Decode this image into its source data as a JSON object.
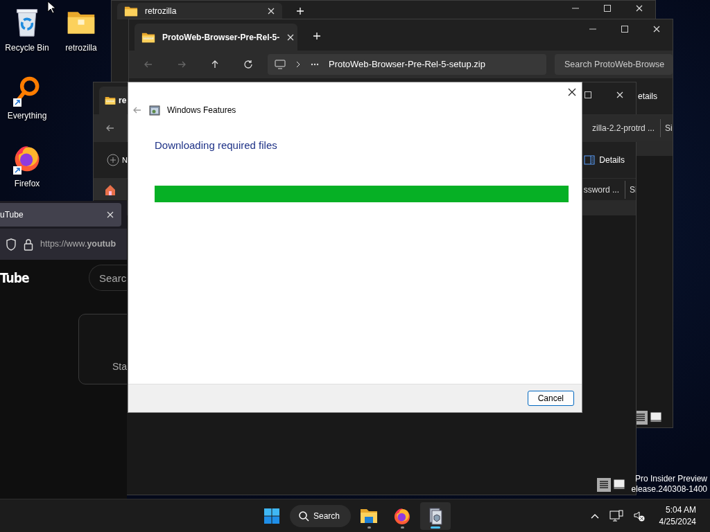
{
  "desktop_icons": [
    {
      "label": "Recycle Bin",
      "kind": "recycle",
      "shortcut": false
    },
    {
      "label": "retrozilla",
      "kind": "folder",
      "shortcut": false
    },
    {
      "label": "Everything",
      "kind": "search",
      "shortcut": true
    },
    {
      "label": "Firefox",
      "kind": "firefox",
      "shortcut": true
    }
  ],
  "explorer_back": {
    "tab_title": "retrozilla"
  },
  "explorer_zip": {
    "tab_title": "ProtoWeb-Browser-Pre-Rel-5-",
    "address": "ProtoWeb-Browser-Pre-Rel-5-setup.zip",
    "search_placeholder": "Search ProtoWeb-Browse",
    "command": "etails",
    "columns": [
      "zilla-2.2-protrd ...",
      "Si"
    ]
  },
  "explorer_front": {
    "tab_title": "re",
    "new_button": "N",
    "command": "Details",
    "columns": [
      "ssword ...",
      "Si"
    ]
  },
  "firefox": {
    "tab_title": "uTube",
    "url": "https://www.**youtub**",
    "logo": "Tube",
    "search_placeholder": "Searc",
    "card_text": "Sta"
  },
  "dialog": {
    "title": "Windows Features",
    "heading": "Downloading required files",
    "progress": {
      "level": 1
    },
    "buttons": [
      "Cancel"
    ]
  },
  "os_build_text": [
    "Pro Insider Preview",
    "elease.240308-1400"
  ],
  "taskbar": {
    "search_label": "Search",
    "apps": [
      {
        "kind": "explorer",
        "active": false
      },
      {
        "kind": "firefox",
        "active": false
      },
      {
        "kind": "features",
        "active": true
      }
    ],
    "time": "5:04 AM",
    "date": "4/25/2024"
  }
}
